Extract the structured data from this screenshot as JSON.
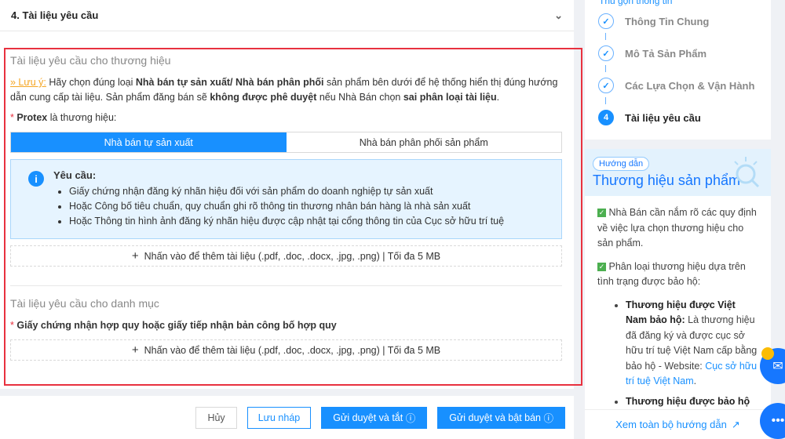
{
  "section": {
    "title": "4. Tài liệu yêu cầu"
  },
  "brand_docs": {
    "heading": "Tài liệu yêu cầu cho thương hiệu",
    "note_label": "» Lưu ý:",
    "note_1": " Hãy chọn đúng loại ",
    "note_b1": "Nhà bán tự sản xuất/ Nhà bán phân phối",
    "note_2": " sản phẩm bên dưới để hệ thống hiển thị đúng hướng dẫn cung cấp tài liệu. Sản phẩm đăng bán sẽ ",
    "note_b2": "không được phê duyệt",
    "note_3": " nếu Nhà Bán chọn ",
    "note_b3": "sai phân loại tài liệu",
    "note_4": ".",
    "brand_name": "Protex",
    "brand_suffix": " là thương hiệu:",
    "options": [
      "Nhà bán tự sản xuất",
      "Nhà bán phân phối sản phẩm"
    ],
    "info_title": "Yêu cầu:",
    "requirements": [
      "Giấy chứng nhận đăng ký nhãn hiệu đối với sản phẩm do doanh nghiệp tự sản xuất",
      "Hoặc Công bố tiêu chuẩn, quy chuẩn ghi rõ thông tin thương nhân bán hàng là nhà sản xuất",
      "Hoặc Thông tin hình ảnh đăng ký nhãn hiệu được cập nhật tại cổng thông tin của Cục sở hữu trí tuệ"
    ],
    "upload": "Nhấn vào để thêm tài liệu (.pdf, .doc, .docx, .jpg, .png) | Tối đa 5 MB"
  },
  "category_docs": {
    "heading": "Tài liệu yêu cầu cho danh mục",
    "field": "Giấy chứng nhận hợp quy hoặc giấy tiếp nhận bản công bố hợp quy",
    "upload": "Nhấn vào để thêm tài liệu (.pdf, .doc, .docx, .jpg, .png) | Tối đa 5 MB"
  },
  "actions": {
    "cancel": "Hủy",
    "draft": "Lưu nháp",
    "submit_off": "Gửi duyệt và tắt",
    "submit_on": "Gửi duyệt và bật bán"
  },
  "steps": {
    "collapse": "Thu gọn thông tin",
    "items": [
      "Thông Tin Chung",
      "Mô Tả Sản Phẩm",
      "Các Lựa Chọn & Vận Hành",
      "Tài liệu yêu cầu"
    ],
    "current_number": "4"
  },
  "guide": {
    "badge": "Hướng dẫn",
    "title": "Thương hiệu sản phẩm",
    "p1": "Nhà Bán cần nắm rõ các quy định về việc lựa chọn thương hiệu cho sản phẩm.",
    "p2": "Phân loại thương hiệu dựa trên tình trạng được bảo hộ:",
    "b1_title": "Thương hiệu được Việt Nam bảo hộ:",
    "b1_text": " Là thương hiệu đã đăng ký và được cục sở hữu trí tuệ Việt Nam cấp bằng bảo hộ - Website: ",
    "b1_link": "Cục sở hữu trí tuệ Việt Nam",
    "b1_end": ".",
    "b2_title": "Thương hiệu được bảo hộ",
    "footer": "Xem toàn bộ hướng dẫn"
  },
  "colors": {
    "primary": "#1890ff",
    "highlight": "#e8313f",
    "note": "#f5a623"
  }
}
